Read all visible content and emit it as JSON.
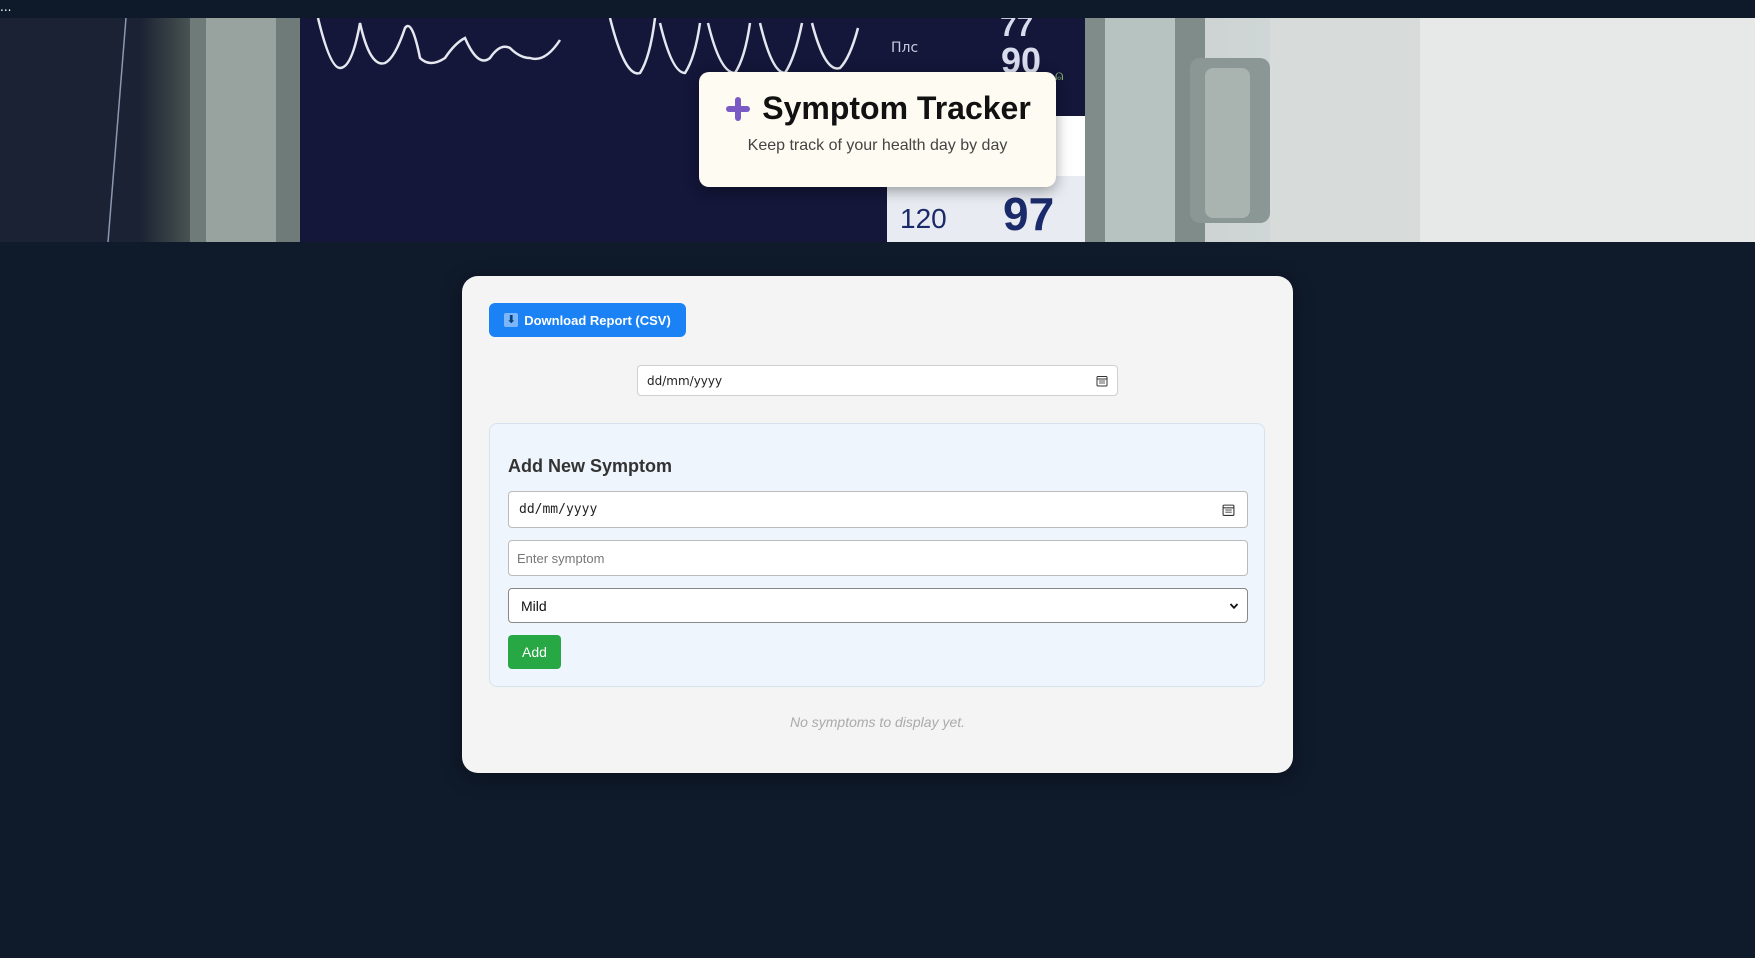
{
  "topbar": {
    "dots": "..."
  },
  "hero": {
    "monitor_label": "Плс",
    "reading_top": "77",
    "reading_mid": "90",
    "reading_left": "120",
    "reading_right": "97"
  },
  "header": {
    "title": "Symptom Tracker",
    "subtitle": "Keep track of your health day by day",
    "icon": "plus-icon"
  },
  "toolbar": {
    "download_label": "Download Report (CSV)",
    "download_icon": "download-icon"
  },
  "filter": {
    "date_placeholder": "dd/mm/yyyy"
  },
  "add_form": {
    "heading": "Add New Symptom",
    "date_placeholder": "dd/mm/yyyy",
    "symptom_placeholder": "Enter symptom",
    "severity_selected": "Mild",
    "add_label": "Add"
  },
  "list": {
    "empty_message": "No symptoms to display yet."
  },
  "colors": {
    "page_bg": "#0f1a2b",
    "panel_bg": "#f4f4f4",
    "download_button": "#1a82f5",
    "add_button": "#28a745",
    "title_card_bg": "#fdfbf2",
    "plus_icon": "#7a5ac4"
  }
}
